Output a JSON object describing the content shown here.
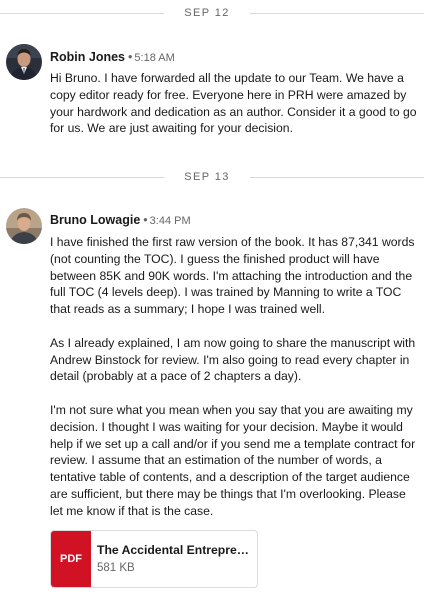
{
  "conversation": {
    "dividers": [
      "SEP 12",
      "SEP 13"
    ],
    "messages": [
      {
        "sender": "Robin Jones",
        "time": "5:18 AM",
        "separator": "•",
        "paragraphs": [
          "Hi Bruno. I have forwarded all the update to our Team. We have a copy editor ready for free. Everyone here in PRH were amazed by your hardwork and dedication as an author. Consider it a good to go for us. We are just awaiting for your decision."
        ]
      },
      {
        "sender": "Bruno Lowagie",
        "time": "3:44 PM",
        "separator": "•",
        "paragraphs": [
          "I have finished the first raw version of the book. It has 87,341 words (not counting the TOC). I guess the finished product will have between 85K and 90K words. I'm attaching the introduction and the full TOC (4 levels deep). I was trained by Manning to write a TOC that reads as a summary; I hope I was trained well.",
          "As I already explained, I am now going to share the manuscript with Andrew Binstock for review. I'm also going to read every chapter in detail (probably at a pace of 2 chapters a day).",
          "I'm not sure what you mean when you say that you are awaiting my decision. I thought I was waiting for your decision. Maybe it would help if we set up a call and/or if you send me a template contract for review. I assume that an estimation of the number of words, a tentative table of contents, and a description of the target audience are sufficient, but there may be things that I'm overlooking. Please let me know if that is the case."
        ],
        "attachment": {
          "type_label": "PDF",
          "name": "The Accidental Entrepreneur",
          "size": "581 KB"
        }
      }
    ]
  },
  "colors": {
    "pdf_red": "#d11124",
    "divider_gray": "#d9d9d9",
    "meta_gray": "#666666"
  }
}
